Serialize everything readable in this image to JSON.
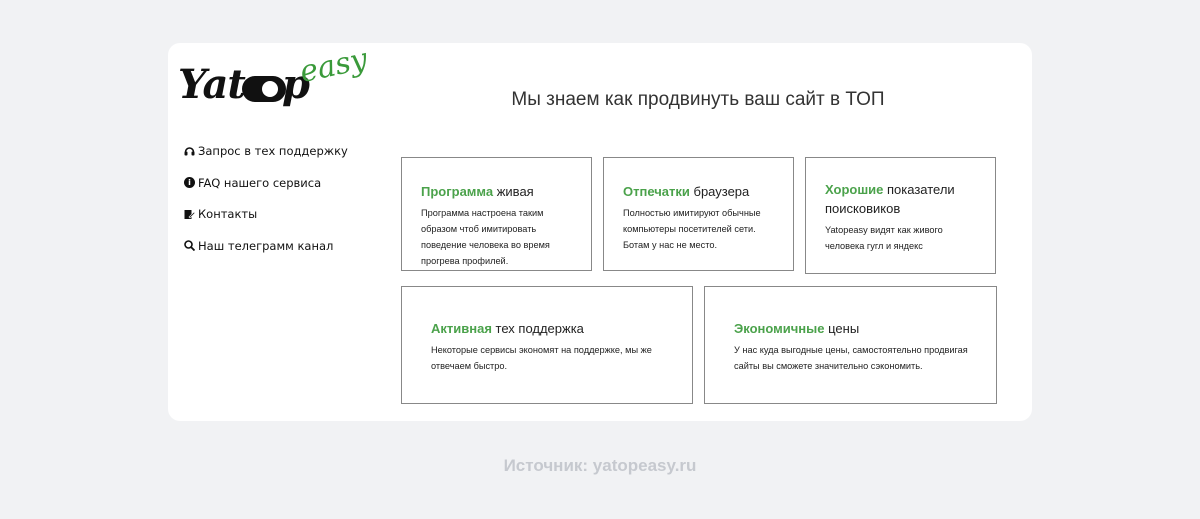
{
  "logo": {
    "part1": "Yat",
    "part2": "p",
    "part3": "easy"
  },
  "nav": {
    "items": [
      {
        "label": "Запрос в тех поддержку",
        "icon": "headset-icon"
      },
      {
        "label": "FAQ нашего сервиса",
        "icon": "info-icon"
      },
      {
        "label": "Контакты",
        "icon": "edit-icon"
      },
      {
        "label": "Наш телеграмм канал",
        "icon": "search-icon"
      }
    ]
  },
  "headline": "Мы знаем как продвинуть ваш сайт в ТОП",
  "features": [
    {
      "highlight": "Программа",
      "rest": " живая",
      "desc": "Программа настроена таким образом чтоб имитировать поведение человека во время прогрева профилей."
    },
    {
      "highlight": "Отпечатки",
      "rest": " браузера",
      "desc": "Полностью имитируют обычные компьютеры посетителей сети. Ботам у нас не место."
    },
    {
      "highlight": "Хорошие",
      "rest": " показатели поисковиков",
      "desc": "Yatopeasy видят как живого человека гугл и яндекс"
    },
    {
      "highlight": "Активная",
      "rest": " тех поддержка",
      "desc": "Некоторые сервисы экономят на поддержке, мы же отвечаем быстро."
    },
    {
      "highlight": "Экономичные",
      "rest": " цены",
      "desc": "У нас куда выгодные цены, самостоятельно продвигая сайты вы сможете значительно сэкономить."
    }
  ],
  "caption": "Источник: yatopeasy.ru",
  "colors": {
    "accent": "#4ba24b",
    "background": "#f1f2f4",
    "card": "#ffffff"
  }
}
